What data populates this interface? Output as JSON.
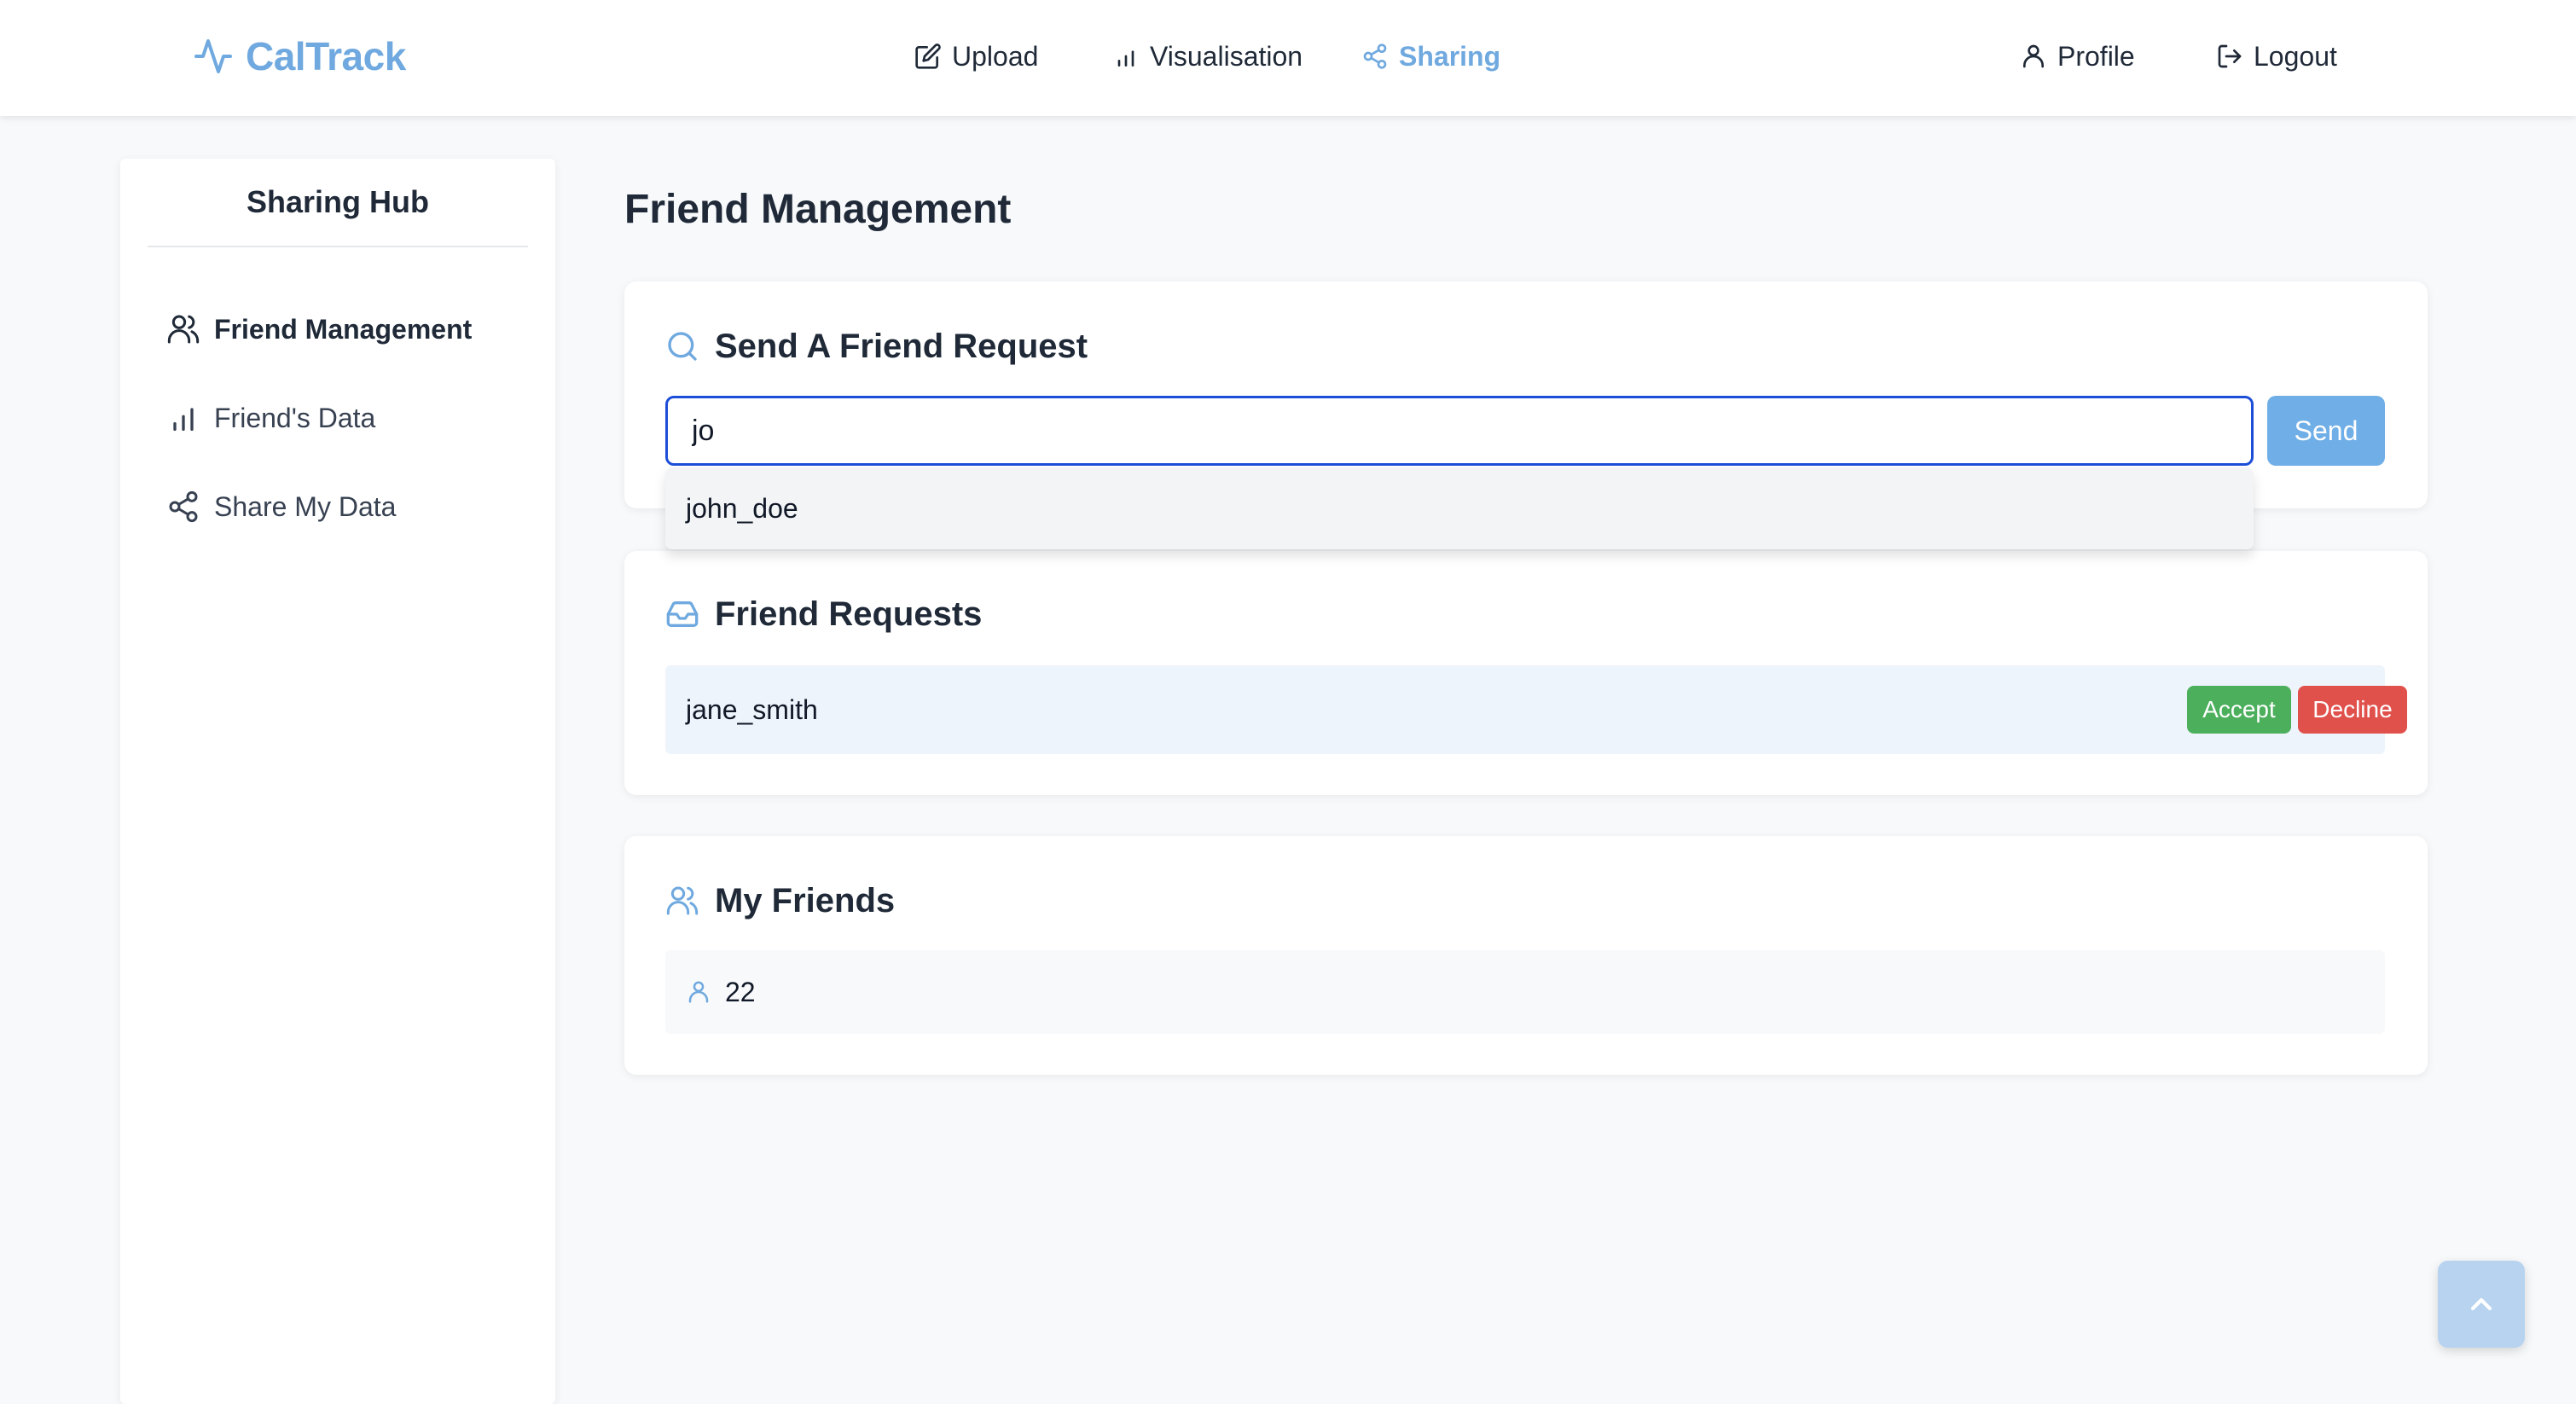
{
  "brand": {
    "name": "CalTrack",
    "color": "#6fa9df",
    "icon": "activity-pulse-icon"
  },
  "nav": {
    "upload": {
      "label": "Upload",
      "icon": "edit-square-icon"
    },
    "visualisation": {
      "label": "Visualisation",
      "icon": "bar-chart-icon"
    },
    "sharing": {
      "label": "Sharing",
      "icon": "share-icon",
      "active": true
    },
    "profile": {
      "label": "Profile",
      "icon": "user-icon"
    },
    "logout": {
      "label": "Logout",
      "icon": "logout-icon"
    }
  },
  "sidebar": {
    "title": "Sharing Hub",
    "items": [
      {
        "label": "Friend Management",
        "icon": "users-icon",
        "active": true
      },
      {
        "label": "Friend's Data",
        "icon": "bar-chart-icon",
        "active": false
      },
      {
        "label": "Share My Data",
        "icon": "share-icon",
        "active": false
      }
    ]
  },
  "main": {
    "title": "Friend Management",
    "send_request": {
      "heading": "Send A Friend Request",
      "icon": "search-icon",
      "input_value": "jo",
      "send_label": "Send",
      "suggestions": [
        "john_doe"
      ]
    },
    "friend_requests": {
      "heading": "Friend Requests",
      "icon": "inbox-icon",
      "items": [
        {
          "username": "jane_smith",
          "accept_label": "Accept",
          "decline_label": "Decline"
        }
      ]
    },
    "my_friends": {
      "heading": "My Friends",
      "icon": "users-icon",
      "items": [
        {
          "username": "22",
          "icon": "user-icon"
        }
      ]
    }
  },
  "colors": {
    "accent": "#6fa9df",
    "send_button": "#6faee6",
    "accept": "#4caf5c",
    "decline": "#e0514c",
    "input_focus_border": "#1d4ed8"
  },
  "scroll_top": {
    "icon": "chevron-up-icon"
  }
}
